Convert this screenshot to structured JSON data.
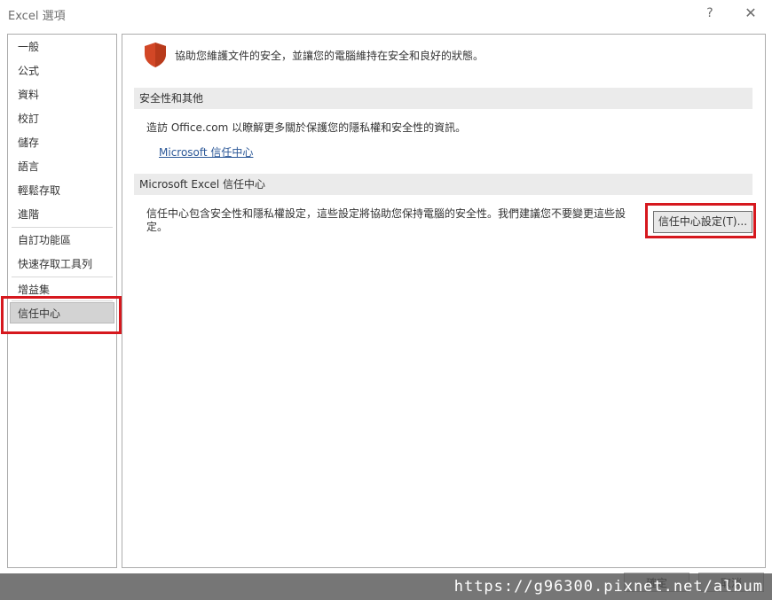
{
  "window": {
    "title": "Excel 選項",
    "help_label": "?",
    "close_label": "✕"
  },
  "sidebar": {
    "items": [
      {
        "label": "一般"
      },
      {
        "label": "公式"
      },
      {
        "label": "資料"
      },
      {
        "label": "校訂"
      },
      {
        "label": "儲存"
      },
      {
        "label": "語言"
      },
      {
        "label": "輕鬆存取"
      },
      {
        "label": "進階"
      },
      {
        "label": "自訂功能區"
      },
      {
        "label": "快速存取工具列"
      },
      {
        "label": "增益集"
      },
      {
        "label": "信任中心"
      }
    ],
    "selected": "信任中心"
  },
  "main": {
    "intro": "協助您維護文件的安全，並讓您的電腦維持在安全和良好的狀態。",
    "privacy_section": {
      "header": "安全性和其他",
      "description": "造訪 Office.com 以瞭解更多關於保護您的隱私權和安全性的資訊。",
      "link": "Microsoft 信任中心"
    },
    "trust_section": {
      "header": "Microsoft Excel 信任中心",
      "description_line1": "信任中心包含安全性和隱私權設定，這些設定將協助您保持電腦的安全性。我們建議您不要變更這些設",
      "description_line2": "定。",
      "button_label": "信任中心設定(T)..."
    }
  },
  "footer": {
    "ok_label": "確定",
    "cancel_label": "取消"
  },
  "watermark": "https://g96300.pixnet.net/album",
  "colors": {
    "highlight": "#d6181e",
    "shield": "#d24726",
    "link": "#2b5797"
  }
}
